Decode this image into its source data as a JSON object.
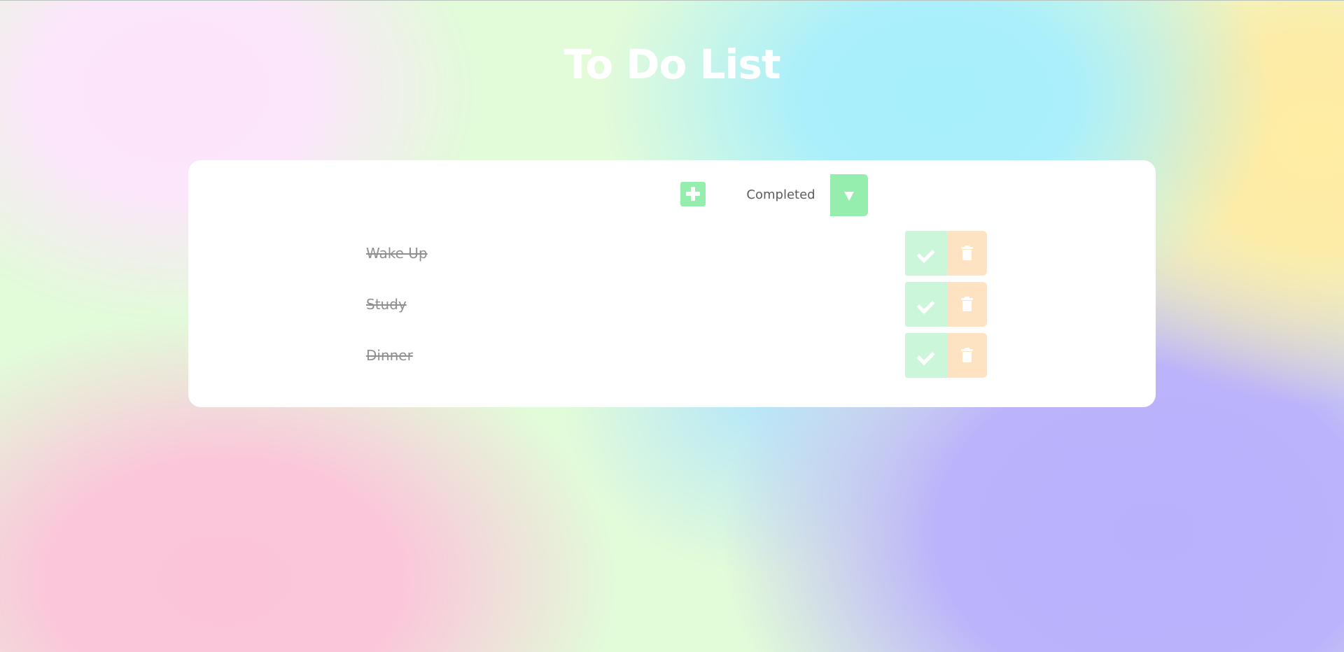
{
  "header": {
    "title": "To Do List"
  },
  "toolbar": {
    "add_icon": "plus-icon",
    "filter": {
      "selected": "Completed",
      "toggle_icon": "chevron-down-icon"
    }
  },
  "todos": [
    {
      "text": "Wake Up",
      "completed": true
    },
    {
      "text": "Study",
      "completed": true
    },
    {
      "text": "Dinner",
      "completed": true
    }
  ],
  "actions": {
    "complete_icon": "check-icon",
    "delete_icon": "trash-icon"
  },
  "colors": {
    "accent_green": "#96eeae",
    "complete_bg": "#cbf6d9",
    "delete_bg": "#fde3c1",
    "card_bg": "#ffffff",
    "completed_text": "#8f8f8f"
  }
}
